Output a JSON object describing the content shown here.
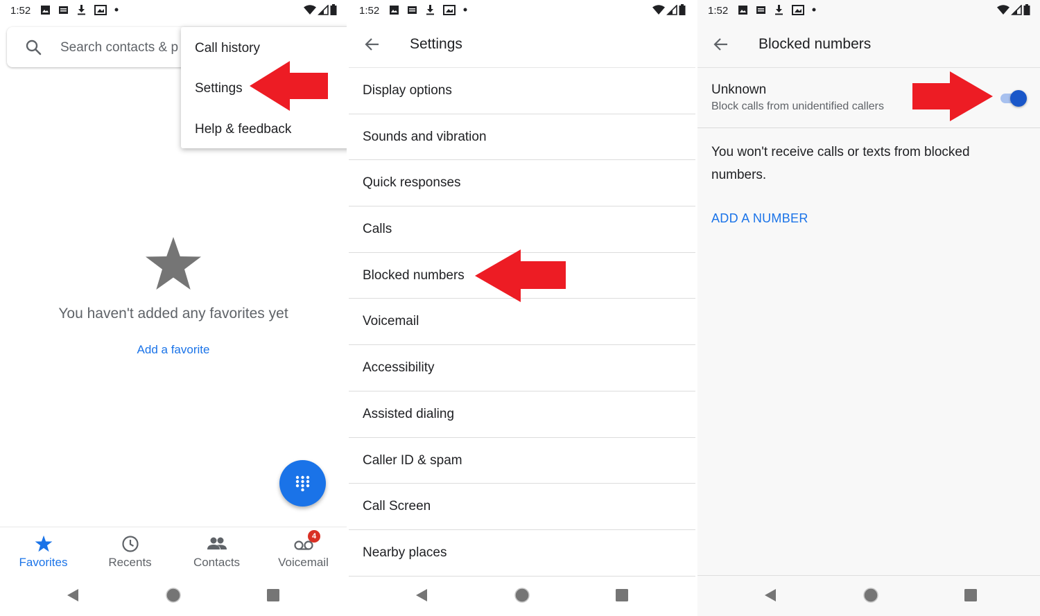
{
  "status_bar": {
    "time": "1:52"
  },
  "panel1": {
    "search": {
      "placeholder": "Search contacts & p"
    },
    "menu": {
      "items": [
        {
          "label": "Call history"
        },
        {
          "label": "Settings"
        },
        {
          "label": "Help & feedback"
        }
      ]
    },
    "empty_state": {
      "message": "You haven't added any favorites yet",
      "action": "Add a favorite"
    },
    "bottom_tabs": [
      {
        "label": "Favorites",
        "icon": "star-icon",
        "active": true
      },
      {
        "label": "Recents",
        "icon": "clock-icon",
        "active": false
      },
      {
        "label": "Contacts",
        "icon": "people-icon",
        "active": false
      },
      {
        "label": "Voicemail",
        "icon": "voicemail-icon",
        "active": false,
        "badge": "4"
      }
    ]
  },
  "panel2": {
    "title": "Settings",
    "items": [
      {
        "label": "Display options"
      },
      {
        "label": "Sounds and vibration"
      },
      {
        "label": "Quick responses"
      },
      {
        "label": "Calls"
      },
      {
        "label": "Blocked numbers"
      },
      {
        "label": "Voicemail"
      },
      {
        "label": "Accessibility"
      },
      {
        "label": "Assisted dialing"
      },
      {
        "label": "Caller ID & spam"
      },
      {
        "label": "Call Screen"
      },
      {
        "label": "Nearby places"
      }
    ]
  },
  "panel3": {
    "title": "Blocked numbers",
    "unknown": {
      "title": "Unknown",
      "subtitle": "Block calls from unidentified callers",
      "enabled": true
    },
    "info": "You won't receive calls or texts from blocked numbers.",
    "add_number": "ADD A NUMBER"
  },
  "colors": {
    "accent": "#1a73e8",
    "annotation_arrow": "#ed1c24",
    "badge": "#d93025"
  }
}
